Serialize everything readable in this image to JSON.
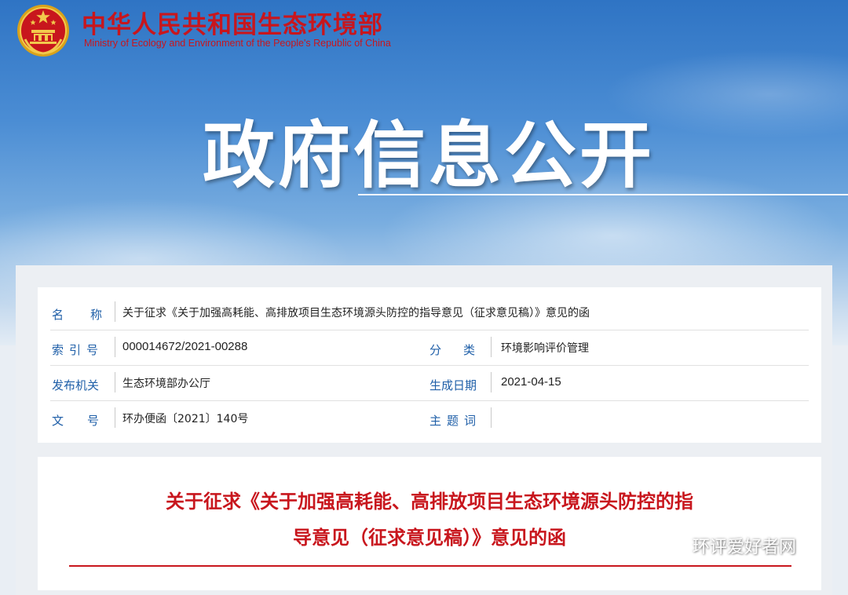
{
  "header": {
    "ministry_cn": "中华人民共和国生态环境部",
    "ministry_en": "Ministry of Ecology and Environment of the People's Republic of China",
    "banner_title": "政府信息公开",
    "emblem_icon": "national-emblem-icon"
  },
  "colors": {
    "brand_red": "#c8161d",
    "label_blue": "#1f5fa8",
    "banner_blue": "#2f74c4"
  },
  "meta": {
    "name_label": "名称",
    "name_value": "关于征求《关于加强高耗能、高排放项目生态环境源头防控的指导意见（征求意见稿）》意见的函",
    "index_label": "索引号",
    "index_value": "000014672/2021-00288",
    "category_label": "分类",
    "category_value": "环境影响评价管理",
    "issuer_label": "发布机关",
    "issuer_value": "生态环境部办公厅",
    "date_label": "生成日期",
    "date_value": "2021-04-15",
    "docno_label": "文号",
    "docno_value": "环办便函〔2021〕140号",
    "keywords_label": "主题词",
    "keywords_value": ""
  },
  "document": {
    "title_line1": "关于征求《关于加强高耗能、高排放项目生态环境源头防控的指",
    "title_line2": "导意见（征求意见稿）》意见的函"
  },
  "watermark": {
    "text": "环评爱好者网",
    "icon": "wechat-icon"
  }
}
